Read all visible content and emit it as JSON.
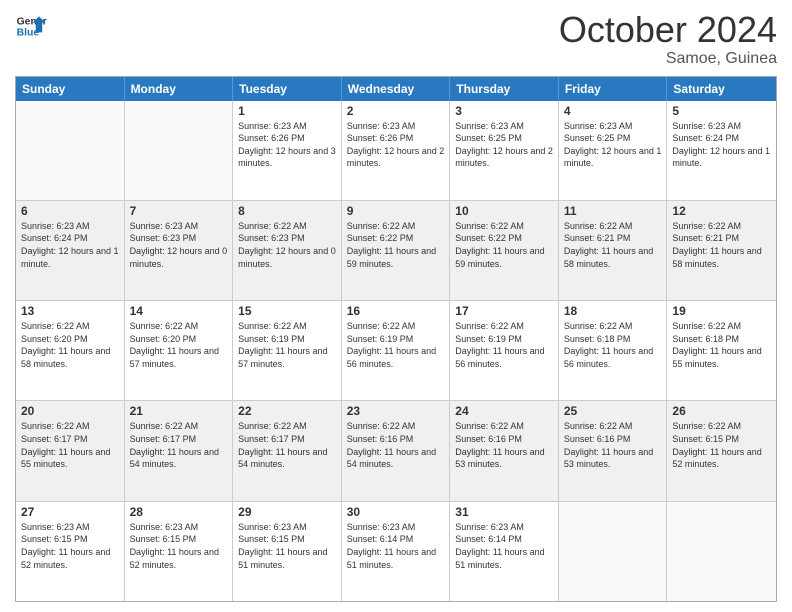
{
  "header": {
    "logo_general": "General",
    "logo_blue": "Blue",
    "month_title": "October 2024",
    "subtitle": "Samoe, Guinea"
  },
  "weekdays": [
    "Sunday",
    "Monday",
    "Tuesday",
    "Wednesday",
    "Thursday",
    "Friday",
    "Saturday"
  ],
  "rows": [
    [
      {
        "day": "",
        "text": "",
        "empty": true
      },
      {
        "day": "",
        "text": "",
        "empty": true
      },
      {
        "day": "1",
        "text": "Sunrise: 6:23 AM\nSunset: 6:26 PM\nDaylight: 12 hours and 3 minutes."
      },
      {
        "day": "2",
        "text": "Sunrise: 6:23 AM\nSunset: 6:26 PM\nDaylight: 12 hours and 2 minutes."
      },
      {
        "day": "3",
        "text": "Sunrise: 6:23 AM\nSunset: 6:25 PM\nDaylight: 12 hours and 2 minutes."
      },
      {
        "day": "4",
        "text": "Sunrise: 6:23 AM\nSunset: 6:25 PM\nDaylight: 12 hours and 1 minute."
      },
      {
        "day": "5",
        "text": "Sunrise: 6:23 AM\nSunset: 6:24 PM\nDaylight: 12 hours and 1 minute."
      }
    ],
    [
      {
        "day": "6",
        "text": "Sunrise: 6:23 AM\nSunset: 6:24 PM\nDaylight: 12 hours and 1 minute.",
        "shaded": true
      },
      {
        "day": "7",
        "text": "Sunrise: 6:23 AM\nSunset: 6:23 PM\nDaylight: 12 hours and 0 minutes.",
        "shaded": true
      },
      {
        "day": "8",
        "text": "Sunrise: 6:22 AM\nSunset: 6:23 PM\nDaylight: 12 hours and 0 minutes.",
        "shaded": true
      },
      {
        "day": "9",
        "text": "Sunrise: 6:22 AM\nSunset: 6:22 PM\nDaylight: 11 hours and 59 minutes.",
        "shaded": true
      },
      {
        "day": "10",
        "text": "Sunrise: 6:22 AM\nSunset: 6:22 PM\nDaylight: 11 hours and 59 minutes.",
        "shaded": true
      },
      {
        "day": "11",
        "text": "Sunrise: 6:22 AM\nSunset: 6:21 PM\nDaylight: 11 hours and 58 minutes.",
        "shaded": true
      },
      {
        "day": "12",
        "text": "Sunrise: 6:22 AM\nSunset: 6:21 PM\nDaylight: 11 hours and 58 minutes.",
        "shaded": true
      }
    ],
    [
      {
        "day": "13",
        "text": "Sunrise: 6:22 AM\nSunset: 6:20 PM\nDaylight: 11 hours and 58 minutes."
      },
      {
        "day": "14",
        "text": "Sunrise: 6:22 AM\nSunset: 6:20 PM\nDaylight: 11 hours and 57 minutes."
      },
      {
        "day": "15",
        "text": "Sunrise: 6:22 AM\nSunset: 6:19 PM\nDaylight: 11 hours and 57 minutes."
      },
      {
        "day": "16",
        "text": "Sunrise: 6:22 AM\nSunset: 6:19 PM\nDaylight: 11 hours and 56 minutes."
      },
      {
        "day": "17",
        "text": "Sunrise: 6:22 AM\nSunset: 6:19 PM\nDaylight: 11 hours and 56 minutes."
      },
      {
        "day": "18",
        "text": "Sunrise: 6:22 AM\nSunset: 6:18 PM\nDaylight: 11 hours and 56 minutes."
      },
      {
        "day": "19",
        "text": "Sunrise: 6:22 AM\nSunset: 6:18 PM\nDaylight: 11 hours and 55 minutes."
      }
    ],
    [
      {
        "day": "20",
        "text": "Sunrise: 6:22 AM\nSunset: 6:17 PM\nDaylight: 11 hours and 55 minutes.",
        "shaded": true
      },
      {
        "day": "21",
        "text": "Sunrise: 6:22 AM\nSunset: 6:17 PM\nDaylight: 11 hours and 54 minutes.",
        "shaded": true
      },
      {
        "day": "22",
        "text": "Sunrise: 6:22 AM\nSunset: 6:17 PM\nDaylight: 11 hours and 54 minutes.",
        "shaded": true
      },
      {
        "day": "23",
        "text": "Sunrise: 6:22 AM\nSunset: 6:16 PM\nDaylight: 11 hours and 54 minutes.",
        "shaded": true
      },
      {
        "day": "24",
        "text": "Sunrise: 6:22 AM\nSunset: 6:16 PM\nDaylight: 11 hours and 53 minutes.",
        "shaded": true
      },
      {
        "day": "25",
        "text": "Sunrise: 6:22 AM\nSunset: 6:16 PM\nDaylight: 11 hours and 53 minutes.",
        "shaded": true
      },
      {
        "day": "26",
        "text": "Sunrise: 6:22 AM\nSunset: 6:15 PM\nDaylight: 11 hours and 52 minutes.",
        "shaded": true
      }
    ],
    [
      {
        "day": "27",
        "text": "Sunrise: 6:23 AM\nSunset: 6:15 PM\nDaylight: 11 hours and 52 minutes."
      },
      {
        "day": "28",
        "text": "Sunrise: 6:23 AM\nSunset: 6:15 PM\nDaylight: 11 hours and 52 minutes."
      },
      {
        "day": "29",
        "text": "Sunrise: 6:23 AM\nSunset: 6:15 PM\nDaylight: 11 hours and 51 minutes."
      },
      {
        "day": "30",
        "text": "Sunrise: 6:23 AM\nSunset: 6:14 PM\nDaylight: 11 hours and 51 minutes."
      },
      {
        "day": "31",
        "text": "Sunrise: 6:23 AM\nSunset: 6:14 PM\nDaylight: 11 hours and 51 minutes."
      },
      {
        "day": "",
        "text": "",
        "empty": true
      },
      {
        "day": "",
        "text": "",
        "empty": true
      }
    ]
  ]
}
